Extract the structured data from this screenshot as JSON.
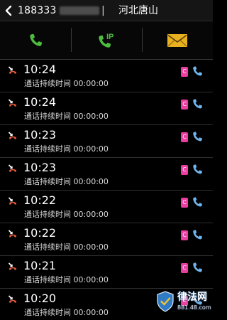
{
  "header": {
    "phone_number": "188333",
    "separator": "|",
    "location": "河北唐山",
    "back_icon": "chevron-left-icon"
  },
  "actions": [
    {
      "name": "call-button",
      "icon": "phone-icon",
      "color": "#4cbd3f"
    },
    {
      "name": "ip-call-button",
      "icon": "ip-phone-icon",
      "icon_text": "IP",
      "color": "#4cbd3f"
    },
    {
      "name": "message-button",
      "icon": "envelope-icon",
      "color": "#e8b11f"
    }
  ],
  "call_log": [
    {
      "time": "10:24",
      "duration": "通话持续时间 00:00:00",
      "sim": "C"
    },
    {
      "time": "10:24",
      "duration": "通话持续时间 00:00:00",
      "sim": "C"
    },
    {
      "time": "10:23",
      "duration": "通话持续时间 00:00:00",
      "sim": "C"
    },
    {
      "time": "10:23",
      "duration": "通话持续时间 00:00:00",
      "sim": "C"
    },
    {
      "time": "10:22",
      "duration": "通话持续时间 00:00:00",
      "sim": "C"
    },
    {
      "time": "10:22",
      "duration": "通话持续时间 00:00:00",
      "sim": "C"
    },
    {
      "time": "10:21",
      "duration": "通话持续时间 00:00:00",
      "sim": "C"
    },
    {
      "time": "10:20",
      "duration": "通话持续时间 00:00:00",
      "sim": "C"
    }
  ],
  "colors": {
    "missed_call": "#e05a3a",
    "sim_badge": "#ec3ea0",
    "row_call_icon": "#6fb6f0",
    "toolbar_call": "#4cbd3f",
    "message": "#e8b11f"
  },
  "watermark": {
    "name": "律法网",
    "url": "881.48.com"
  }
}
